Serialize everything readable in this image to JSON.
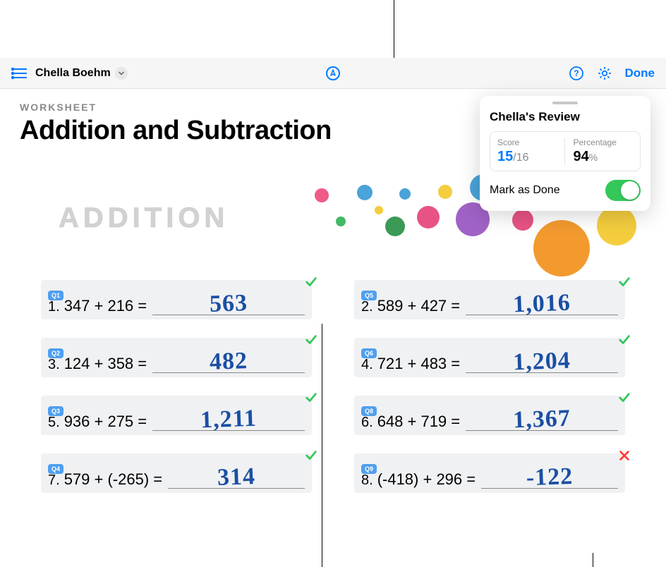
{
  "toolbar": {
    "student_name": "Chella Boehm",
    "done_label": "Done"
  },
  "document": {
    "label": "WORKSHEET",
    "title": "Addition and Subtraction",
    "section_heading": "ADDITION"
  },
  "review": {
    "title": "Chella's Review",
    "score_label": "Score",
    "score_value": "15",
    "score_max": "/16",
    "percentage_label": "Percentage",
    "percentage_value": "94",
    "percentage_symbol": "%",
    "mark_done_label": "Mark as Done",
    "mark_done_on": true
  },
  "questions": [
    {
      "tag": "Q1",
      "num": "1.",
      "prompt": "347 + 216 =",
      "answer": "563",
      "correct": true
    },
    {
      "tag": "Q5",
      "num": "2.",
      "prompt": "589 + 427 =",
      "answer": "1,016",
      "correct": true
    },
    {
      "tag": "Q2",
      "num": "3.",
      "prompt": "124 + 358 =",
      "answer": "482",
      "correct": true
    },
    {
      "tag": "Q6",
      "num": "4.",
      "prompt": "721 + 483 =",
      "answer": "1,204",
      "correct": true
    },
    {
      "tag": "Q3",
      "num": "5.",
      "prompt": "936 + 275 =",
      "answer": "1,211",
      "correct": true
    },
    {
      "tag": "Q8",
      "num": "6.",
      "prompt": "648 + 719 =",
      "answer": "1,367",
      "correct": true
    },
    {
      "tag": "Q4",
      "num": "7.",
      "prompt": "579 + (-265) =",
      "answer": "314",
      "correct": true
    },
    {
      "tag": "Q9",
      "num": "8.",
      "prompt": "(-418) + 296 =",
      "answer": "-122",
      "correct": false
    }
  ],
  "colors": {
    "accent": "#007aff",
    "check": "#34c759",
    "error": "#ff3b30",
    "handwriting": "#1a4fa3"
  }
}
